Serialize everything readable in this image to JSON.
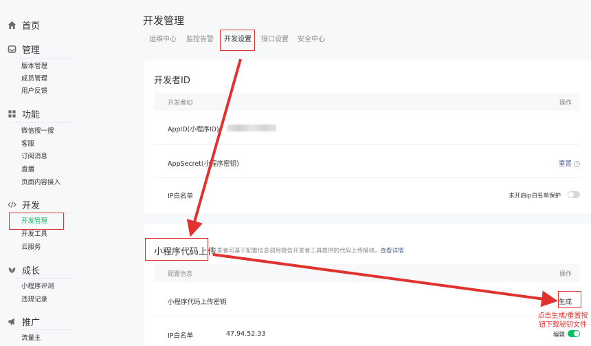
{
  "sidebar": {
    "home": {
      "label": "首页",
      "icon": "home-icon"
    },
    "groups": [
      {
        "key": "manage",
        "label": "管理",
        "icon": "inbox-icon",
        "items": [
          "版本管理",
          "成员管理",
          "用户反馈"
        ]
      },
      {
        "key": "features",
        "label": "功能",
        "icon": "grid-icon",
        "items": [
          "微信搜一搜",
          "客服",
          "订阅消息",
          "直播",
          "页面内容接入"
        ]
      },
      {
        "key": "dev",
        "label": "开发",
        "icon": "code-icon",
        "items": [
          "开发管理",
          "开发工具",
          "云服务"
        ]
      },
      {
        "key": "growth",
        "label": "成长",
        "icon": "leaf-icon",
        "items": [
          "小程序评测",
          "违规记录"
        ]
      },
      {
        "key": "promo",
        "label": "推广",
        "icon": "megaphone-icon",
        "items": [
          "流量主"
        ]
      }
    ],
    "active_item": "开发管理"
  },
  "page": {
    "title": "开发管理",
    "tabs": [
      "运维中心",
      "监控告警",
      "开发设置",
      "接口设置",
      "安全中心"
    ],
    "active_tab": "开发设置"
  },
  "developer_id": {
    "title": "开发者ID",
    "col_name": "开发者ID",
    "col_action": "操作",
    "rows": {
      "appid": {
        "label": "AppID(小程序ID)"
      },
      "appsecret": {
        "label": "AppSecret(小程序密钥)",
        "action": "重置",
        "help": "?"
      },
      "ip_whitelist": {
        "label": "IP白名单",
        "status": "未开启ip白名单保护",
        "toggle_on": false
      }
    }
  },
  "upload": {
    "title": "小程序代码上传",
    "desc": "开发者可基于配置信息调用微信开发者工具提供的代码上传模块。",
    "desc_link": "查看详情",
    "col_config": "配置信息",
    "col_action": "操作",
    "rows": {
      "key": {
        "label": "小程序代码上传密钥",
        "action": "生成"
      },
      "ip": {
        "label": "IP白名单",
        "value": "47.94.52.33",
        "action": "编辑",
        "toggle_on": true
      }
    }
  },
  "annotation": {
    "note_line1": "点击生成/重置按",
    "note_line2": "钮下载秘钥文件",
    "color": "#e0322e"
  },
  "colors": {
    "accent": "#07c160",
    "link": "#576b95",
    "annotation": "#e0322e"
  }
}
